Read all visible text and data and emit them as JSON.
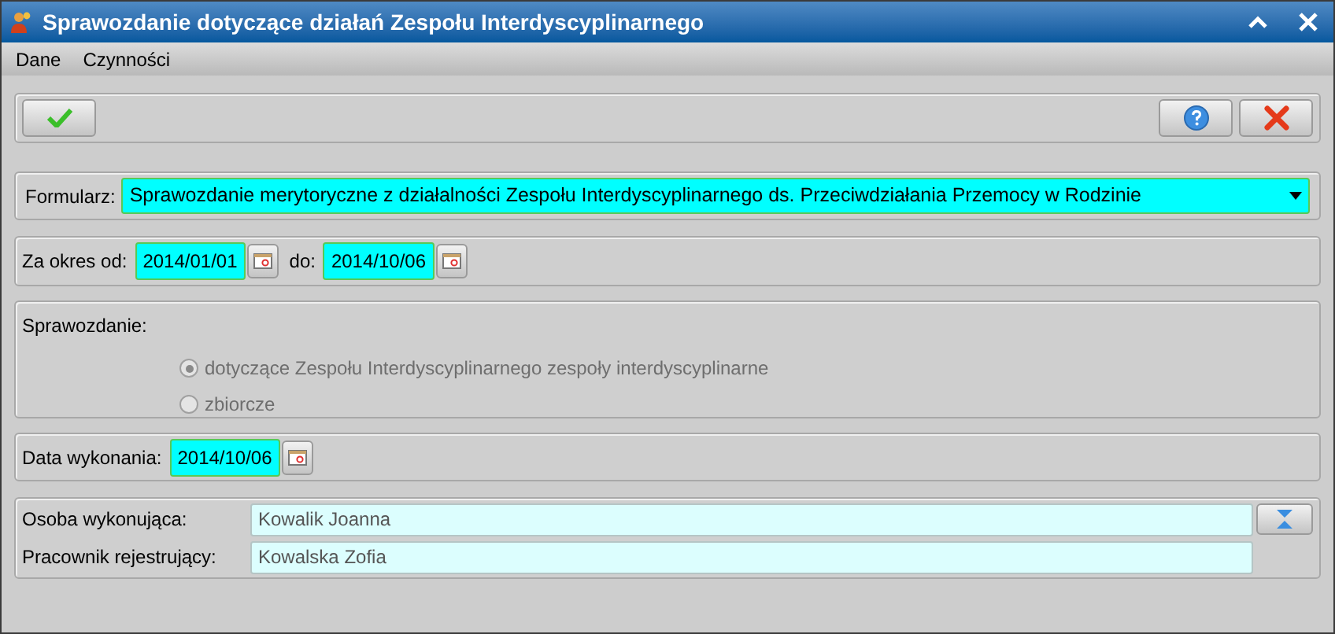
{
  "window": {
    "title": "Sprawozdanie dotyczące działań Zespołu Interdyscyplinarnego"
  },
  "menu": [
    {
      "label": "Dane"
    },
    {
      "label": "Czynności"
    }
  ],
  "toolbar": {
    "buttons": [
      {
        "kind": "confirm"
      },
      {
        "kind": "help"
      },
      {
        "kind": "cancel"
      }
    ]
  },
  "form": {
    "label": "Formularz:",
    "value": "Sprawozdanie merytoryczne z działalności Zespołu Interdyscyplinarnego ds. Przeciwdziałania Przemocy w Rodzinie"
  },
  "period": {
    "from_label": "Za okres od:",
    "from": "2014/01/01",
    "to_label": "do:",
    "to": "2014/10/06"
  },
  "report": {
    "label": "Sprawozdanie:",
    "options": [
      {
        "label": "dotyczące Zespołu Interdyscyplinarnego zespoły interdyscyplinarne",
        "selected": true,
        "disabled": true
      },
      {
        "label": "zbiorcze",
        "selected": false,
        "disabled": true
      }
    ]
  },
  "execution": {
    "label": "Data wykonania:",
    "value": "2014/10/06"
  },
  "people": [
    {
      "label": "Osoba wykonująca:",
      "value": "Kowalik Joanna",
      "has_button": true
    },
    {
      "label": "Pracownik rejestrujący:",
      "value": "Kowalska Zofia",
      "has_button": false
    }
  ]
}
